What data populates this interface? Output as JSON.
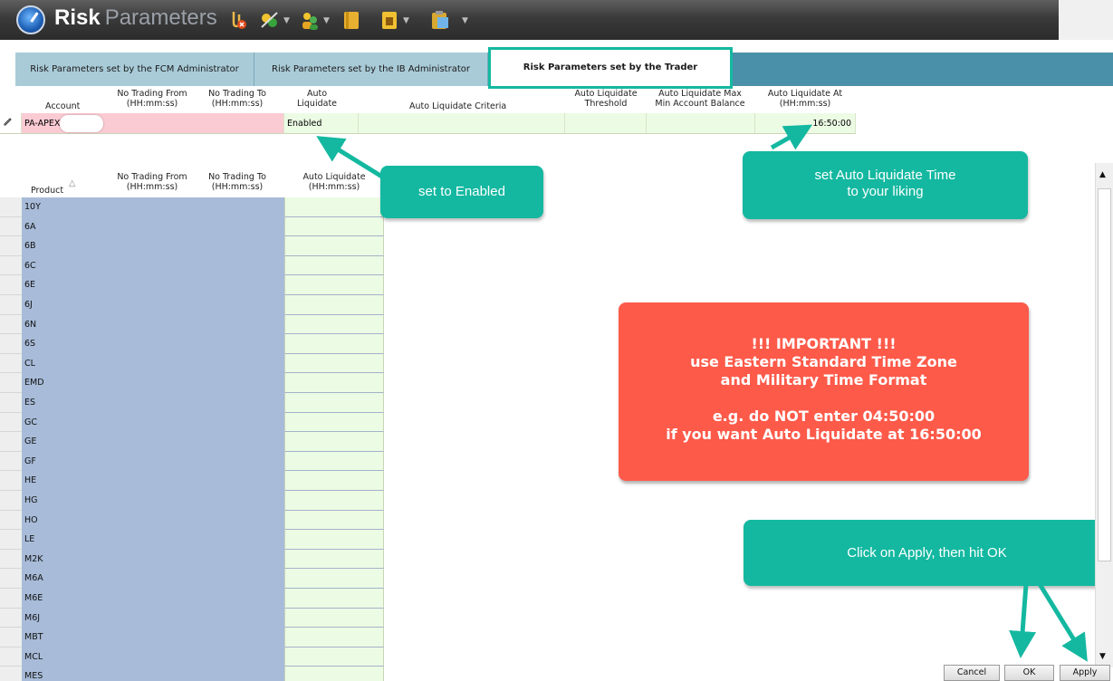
{
  "window": {
    "title_bold": "Risk",
    "title_thin": "Parameters",
    "toolbar_icons": [
      "clip-delete-icon",
      "wand-icon",
      "people-icon",
      "notebook-icon",
      "template-icon",
      "clipboard-icon"
    ]
  },
  "tabs": [
    {
      "label": "Risk Parameters set by the FCM Administrator",
      "active": false
    },
    {
      "label": "Risk Parameters set by the IB Administrator",
      "active": false
    },
    {
      "label": "Risk Parameters set by the Trader",
      "active": true
    }
  ],
  "account_table": {
    "headers": {
      "account": "Account",
      "no_trading_from": [
        "No Trading From",
        "(HH:mm:ss)"
      ],
      "no_trading_to": [
        "No Trading To",
        "(HH:mm:ss)"
      ],
      "auto_liquidate": [
        "Auto",
        "Liquidate"
      ],
      "criteria": "Auto Liquidate Criteria",
      "threshold": [
        "Auto Liquidate",
        "Threshold"
      ],
      "max_min": [
        "Auto Liquidate Max",
        "Min Account Balance"
      ],
      "at": [
        "Auto Liquidate At",
        "(HH:mm:ss)"
      ]
    },
    "row": {
      "account": "PA-APEX-",
      "auto_liquidate": "Enabled",
      "at": "16:50:00"
    }
  },
  "product_table": {
    "headers": {
      "product": "Product",
      "no_trading_from": [
        "No Trading From",
        "(HH:mm:ss)"
      ],
      "no_trading_to": [
        "No Trading To",
        "(HH:mm:ss)"
      ],
      "auto_liquidate": [
        "Auto Liquidate",
        "(HH:mm:ss)"
      ]
    },
    "products": [
      "10Y",
      "6A",
      "6B",
      "6C",
      "6E",
      "6J",
      "6N",
      "6S",
      "CL",
      "EMD",
      "ES",
      "GC",
      "GE",
      "GF",
      "HE",
      "HG",
      "HO",
      "LE",
      "M2K",
      "M6A",
      "M6E",
      "M6J",
      "MBT",
      "MCL",
      "MES"
    ]
  },
  "callouts": {
    "enabled": "set to Enabled",
    "time_line1": "set Auto Liquidate Time",
    "time_line2": "to your liking",
    "apply": "Click on Apply, then hit OK"
  },
  "important": {
    "line1": "!!! IMPORTANT !!!",
    "line2": "use Eastern Standard Time Zone",
    "line3": "and Military Time Format",
    "line4": "e.g. do NOT enter 04:50:00",
    "line5": "if you want Auto Liquidate at 16:50:00"
  },
  "buttons": {
    "cancel": "Cancel",
    "ok": "OK",
    "apply": "Apply"
  },
  "colors": {
    "accent": "#14b8a0",
    "warning": "#fd5a4a",
    "tab_bar": "#4a90a8"
  }
}
